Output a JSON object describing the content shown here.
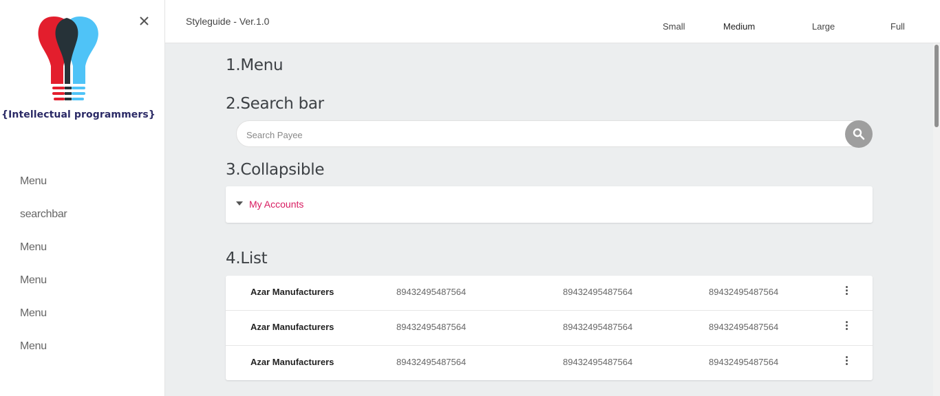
{
  "logo": {
    "text": "{Intellectual programmers}"
  },
  "sidebar": {
    "items": [
      {
        "label": "Menu"
      },
      {
        "label": "searchbar"
      },
      {
        "label": "Menu"
      },
      {
        "label": "Menu"
      },
      {
        "label": "Menu"
      },
      {
        "label": "Menu"
      }
    ]
  },
  "header": {
    "title": "Styleguide - Ver.1.0",
    "sizes": [
      "Small",
      "Medium",
      "Large",
      "Full"
    ],
    "active_size": "Medium"
  },
  "sections": {
    "menu_title": "1.Menu",
    "search_title": "2.Search bar",
    "collapsible_title": "3.Collapsible",
    "list_title": "4.List"
  },
  "search": {
    "placeholder": "Search Payee",
    "value": ""
  },
  "collapsible": {
    "label": "My Accounts"
  },
  "list": {
    "rows": [
      {
        "name": "Azar Manufacturers",
        "col1": "89432495487564",
        "col2": "89432495487564",
        "col3": "89432495487564"
      },
      {
        "name": "Azar Manufacturers",
        "col1": "89432495487564",
        "col2": "89432495487564",
        "col3": "89432495487564"
      },
      {
        "name": "Azar Manufacturers",
        "col1": "89432495487564",
        "col2": "89432495487564",
        "col3": "89432495487564"
      }
    ]
  },
  "colors": {
    "accent": "#d81b60",
    "logo_red": "#e31e2d",
    "logo_blue": "#4fc3f7",
    "logo_dark": "#263238",
    "search_button": "#9e9e9e"
  },
  "icons": {
    "close": "close-icon",
    "search": "search-icon",
    "caret": "caret-down-icon",
    "more": "more-vert-icon"
  }
}
